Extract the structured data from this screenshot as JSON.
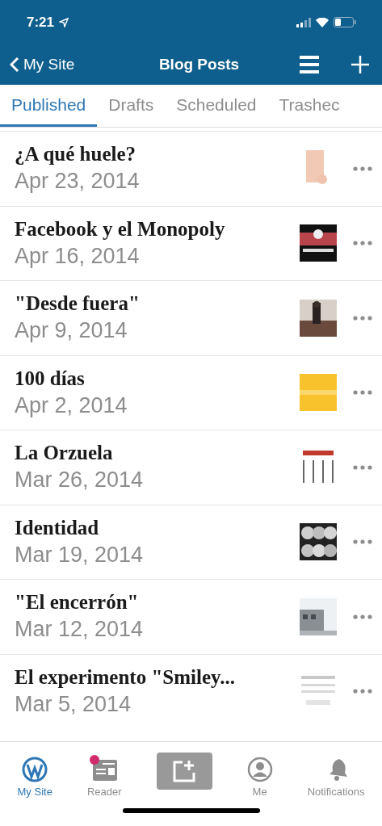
{
  "status_bar": {
    "time": "7:21"
  },
  "nav": {
    "back": "My Site",
    "title": "Blog Posts"
  },
  "tabs": [
    {
      "label": "Published",
      "selected": true
    },
    {
      "label": "Drafts",
      "selected": false
    },
    {
      "label": "Scheduled",
      "selected": false
    },
    {
      "label": "Trashec",
      "selected": false
    }
  ],
  "posts": [
    {
      "title": "¿A qué huele?",
      "date": "Apr 23, 2014"
    },
    {
      "title": "Facebook y el Monopoly",
      "date": "Apr 16, 2014"
    },
    {
      "title": "\"Desde fuera\"",
      "date": "Apr 9, 2014"
    },
    {
      "title": "100 días",
      "date": "Apr 2, 2014"
    },
    {
      "title": "La Orzuela",
      "date": "Mar 26, 2014"
    },
    {
      "title": "Identidad",
      "date": "Mar 19, 2014"
    },
    {
      "title": "\"El encerrón\"",
      "date": "Mar 12, 2014"
    },
    {
      "title": "El experimento \"Smiley...",
      "date": "Mar 5, 2014"
    }
  ],
  "tab_bar": [
    {
      "kind": "mysite",
      "label": "My Site",
      "selected": true
    },
    {
      "kind": "reader",
      "label": "Reader",
      "selected": false,
      "unread": true
    },
    {
      "kind": "write"
    },
    {
      "kind": "me",
      "label": "Me",
      "selected": false
    },
    {
      "kind": "notifications",
      "label": "Notifications",
      "selected": false
    }
  ]
}
